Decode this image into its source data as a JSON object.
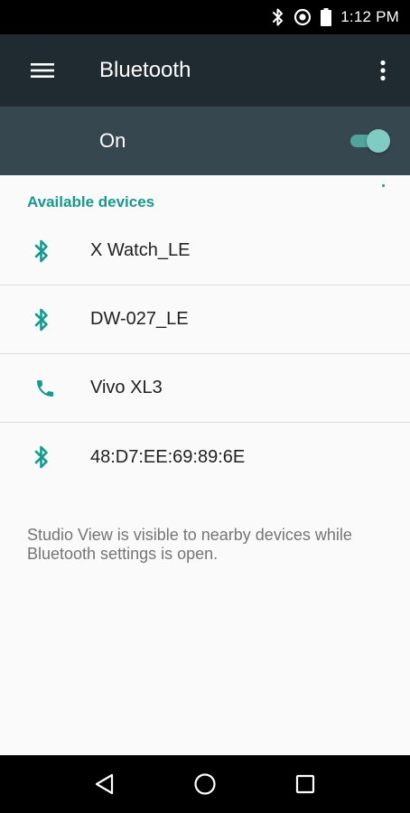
{
  "status_bar": {
    "time": "1:12 PM",
    "icons": [
      "bluetooth-icon",
      "do-not-disturb-icon",
      "battery-icon"
    ]
  },
  "app_bar": {
    "title": "Bluetooth",
    "menu_icon": "hamburger-menu-icon",
    "overflow_icon": "more-vert-icon"
  },
  "master_switch": {
    "label": "On",
    "state": true,
    "colors": {
      "track": "#4fa59c",
      "thumb": "#80cbc4"
    }
  },
  "available_devices": {
    "header": "Available devices",
    "devices": [
      {
        "name": "X Watch_LE",
        "icon": "bluetooth-icon"
      },
      {
        "name": "DW-027_LE",
        "icon": "bluetooth-icon"
      },
      {
        "name": "Vivo XL3",
        "icon": "phone-icon"
      },
      {
        "name": "48:D7:EE:69:89:6E",
        "icon": "bluetooth-icon"
      }
    ]
  },
  "footer": {
    "visibility_text": "Studio View is visible to nearby devices while Bluetooth settings is open."
  },
  "nav_bar": {
    "buttons": [
      "back-icon",
      "home-icon",
      "recents-icon"
    ]
  },
  "colors": {
    "accent": "#169a8f",
    "app_bar": "#1f2b31",
    "switch_bar": "#37474f",
    "background": "#fafafa"
  }
}
